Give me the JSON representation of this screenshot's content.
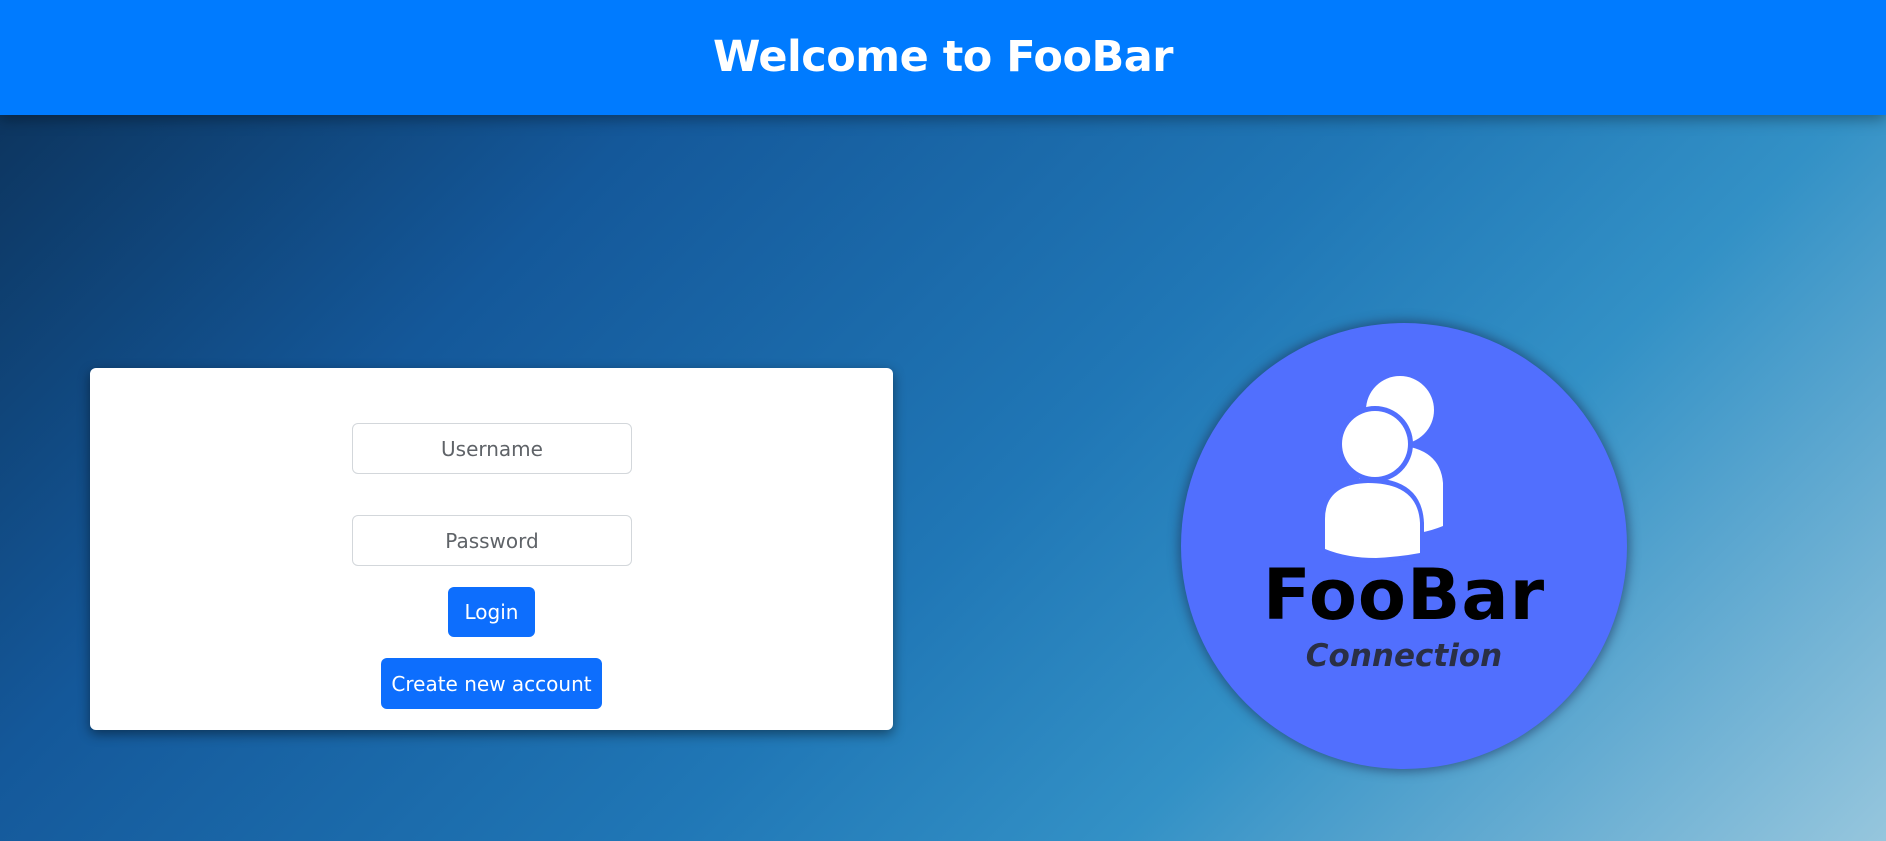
{
  "header": {
    "title": "Welcome to FooBar",
    "background_color": "#007bff"
  },
  "login_form": {
    "username": {
      "placeholder": "Username",
      "value": ""
    },
    "password": {
      "placeholder": "Password",
      "value": ""
    },
    "login_label": "Login",
    "create_account_label": "Create new account",
    "button_color": "#0d6efd"
  },
  "logo": {
    "title": "FooBar",
    "subtitle": "Connection",
    "icon": "users-icon",
    "circle_color": "#516ffe"
  }
}
